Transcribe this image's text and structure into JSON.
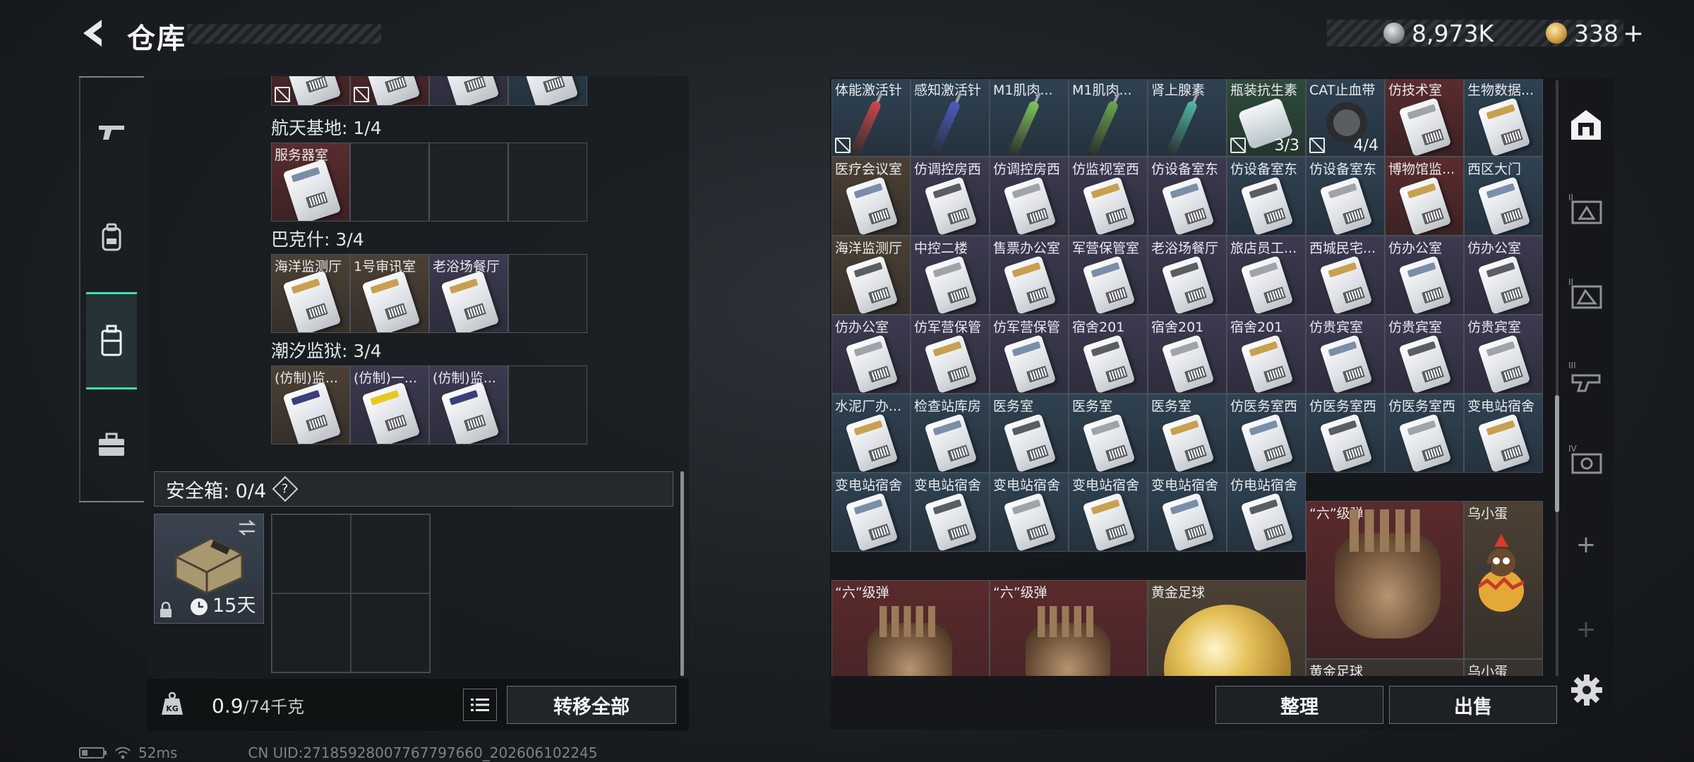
{
  "header": {
    "title": "仓库"
  },
  "currency": {
    "silver": "8,973K",
    "gold": "338",
    "gold_plus": "+"
  },
  "left_nav": {
    "items": [
      "gun-icon",
      "backpack-icon",
      "storage-case-icon",
      "toolbox-icon"
    ],
    "active_index": 2
  },
  "key_groups": [
    {
      "label": "航天基地: 1/4",
      "slots": [
        {
          "name": "服务器室",
          "color": "red"
        },
        null,
        null,
        null
      ]
    },
    {
      "label": "巴克什: 3/4",
      "slots": [
        {
          "name": "海洋监测厅",
          "color": "brown"
        },
        {
          "name": "1号审讯室",
          "color": "brown"
        },
        {
          "name": "老浴场餐厅",
          "color": "purple"
        },
        null
      ]
    },
    {
      "label": "潮汐监狱: 3/4",
      "slots": [
        {
          "name": "(仿制)监...",
          "color": "brown"
        },
        {
          "name": "(仿制)一...",
          "color": "purple"
        },
        {
          "name": "(仿制)监...",
          "color": "purple"
        },
        null
      ]
    }
  ],
  "safe_box": {
    "label": "安全箱: 0/4",
    "help": "?",
    "duration": "15天"
  },
  "weight": {
    "current": "0.9",
    "max": "/74千克"
  },
  "buttons": {
    "transfer_all": "转移全部",
    "sort": "整理",
    "sell": "出售"
  },
  "status": {
    "ping": "52ms",
    "uid": "CN UID:27185928007767797660_202606102245"
  },
  "stash": {
    "row1": [
      {
        "name": "体能激活针",
        "kind": "syringe",
        "accent": "#c9464e",
        "bg": "blue",
        "nosell": true
      },
      {
        "name": "感知激活针",
        "kind": "syringe",
        "accent": "#4a5ec4",
        "bg": "blue"
      },
      {
        "name": "M1肌肉...",
        "kind": "syringe",
        "accent": "#7fc45a",
        "bg": "blue"
      },
      {
        "name": "M1肌肉...",
        "kind": "syringe",
        "accent": "#6aa64e",
        "bg": "blue"
      },
      {
        "name": "肾上腺素",
        "kind": "syringe",
        "accent": "#4fb8a0",
        "bg": "blue"
      },
      {
        "name": "瓶装抗生素",
        "kind": "bottle",
        "bg": "green",
        "nosell": true,
        "qty": "3/3"
      },
      {
        "name": "CAT止血带",
        "kind": "tourniquet",
        "bg": "blue",
        "nosell": true,
        "qty": "4/4"
      },
      {
        "name": "仿技术室",
        "kind": "card",
        "bg": "red"
      },
      {
        "name": "生物数据...",
        "kind": "card",
        "bg": "blue"
      }
    ],
    "row2": [
      {
        "name": "医疗会议室",
        "bg": "brown"
      },
      {
        "name": "仿调控房西",
        "bg": "purple"
      },
      {
        "name": "仿调控房西",
        "bg": "purple"
      },
      {
        "name": "仿监视室西",
        "bg": "purple"
      },
      {
        "name": "仿设备室东",
        "bg": "purple"
      },
      {
        "name": "仿设备室东",
        "bg": "blue"
      },
      {
        "name": "仿设备室东",
        "bg": "blue"
      },
      {
        "name": "博物馆监...",
        "bg": "red"
      },
      {
        "name": "西区大门",
        "bg": "blue"
      }
    ],
    "row3": [
      {
        "name": "海洋监测厅",
        "bg": "brown"
      },
      {
        "name": "中控二楼",
        "bg": "purple"
      },
      {
        "name": "售票办公室",
        "bg": "purple"
      },
      {
        "name": "军营保管室",
        "bg": "purple"
      },
      {
        "name": "老浴场餐厅",
        "bg": "purple"
      },
      {
        "name": "旅店员工...",
        "bg": "purple"
      },
      {
        "name": "西城民宅...",
        "bg": "purple"
      },
      {
        "name": "仿办公室",
        "bg": "purple"
      },
      {
        "name": "仿办公室",
        "bg": "purple"
      }
    ],
    "row4": [
      {
        "name": "仿办公室",
        "bg": "purple"
      },
      {
        "name": "仿军营保管",
        "bg": "purple"
      },
      {
        "name": "仿军营保管",
        "bg": "purple"
      },
      {
        "name": "宿舍201",
        "bg": "purple"
      },
      {
        "name": "宿舍201",
        "bg": "purple"
      },
      {
        "name": "宿舍201",
        "bg": "purple"
      },
      {
        "name": "仿贵宾室",
        "bg": "purple"
      },
      {
        "name": "仿贵宾室",
        "bg": "purple"
      },
      {
        "name": "仿贵宾室",
        "bg": "purple"
      }
    ],
    "row5": [
      {
        "name": "水泥厂办...",
        "bg": "blue"
      },
      {
        "name": "检查站库房",
        "bg": "blue"
      },
      {
        "name": "医务室",
        "bg": "blue"
      },
      {
        "name": "医务室",
        "bg": "blue"
      },
      {
        "name": "医务室",
        "bg": "blue"
      },
      {
        "name": "仿医务室西",
        "bg": "blue"
      },
      {
        "name": "仿医务室西",
        "bg": "blue"
      },
      {
        "name": "仿医务室西",
        "bg": "blue"
      },
      {
        "name": "变电站宿舍",
        "bg": "blue"
      }
    ],
    "row6": [
      {
        "name": "变电站宿舍",
        "bg": "blue"
      },
      {
        "name": "变电站宿舍",
        "bg": "blue"
      },
      {
        "name": "变电站宿舍",
        "bg": "blue"
      },
      {
        "name": "变电站宿舍",
        "bg": "blue"
      },
      {
        "name": "变电站宿舍",
        "bg": "blue"
      },
      {
        "name": "仿电站宿舍",
        "bg": "blue"
      }
    ],
    "big_items": {
      "six_round_1": "“六”级弹",
      "six_round_2": "“六”级弹",
      "six_round_3": "“六”级弹",
      "golden_ball": "黄金足球",
      "golden_ball_2": "黄金足球",
      "egg_1": "乌小蛋",
      "egg_2": "乌小蛋"
    }
  },
  "right_tabs": [
    "vault-icon",
    "case-ii-icon",
    "case-ii-b-icon",
    "case-iii-icon",
    "case-iv-icon"
  ],
  "colors": {
    "accent_green": "#3ee0a8",
    "panel": "#181c20"
  }
}
